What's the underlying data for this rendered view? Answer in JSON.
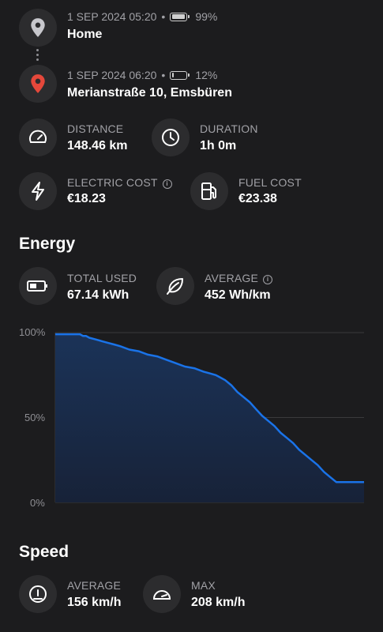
{
  "trip": {
    "start": {
      "datetime": "1 SEP 2024 05:20",
      "battery": "99%",
      "battery_level": 0.99,
      "place": "Home"
    },
    "end": {
      "datetime": "1 SEP 2024 06:20",
      "battery": "12%",
      "battery_level": 0.12,
      "place": "Merianstraße 10, Emsbüren"
    }
  },
  "stats": {
    "distance": {
      "label": "DISTANCE",
      "value": "148.46 km"
    },
    "duration": {
      "label": "DURATION",
      "value": "1h 0m"
    },
    "electric_cost": {
      "label": "ELECTRIC COST",
      "value": "€18.23"
    },
    "fuel_cost": {
      "label": "FUEL COST",
      "value": "€23.38"
    }
  },
  "energy": {
    "title": "Energy",
    "total_used": {
      "label": "TOTAL USED",
      "value": "67.14 kWh"
    },
    "average": {
      "label": "AVERAGE",
      "value": "452 Wh/km"
    }
  },
  "speed": {
    "title": "Speed",
    "average": {
      "label": "AVERAGE",
      "value": "156 km/h"
    },
    "max": {
      "label": "MAX",
      "value": "208 km/h"
    }
  },
  "colors": {
    "accent": "#1a73e8",
    "fill": "#1b3358",
    "pin_end": "#e5483b",
    "pin_start": "#c7c7cc"
  },
  "chart_data": {
    "type": "area",
    "y_ticks": [
      "100%",
      "50%",
      "0%"
    ],
    "ylim": [
      0,
      100
    ],
    "x": [
      0,
      8,
      9,
      10,
      11,
      13,
      15,
      17,
      19,
      21,
      24,
      27,
      30,
      33,
      36,
      39,
      42,
      45,
      48,
      50,
      52,
      53,
      55,
      57,
      59,
      61,
      63,
      65,
      67,
      69,
      71,
      73,
      75,
      77,
      79,
      81,
      83,
      85,
      87,
      89,
      91,
      93,
      95,
      97,
      100
    ],
    "values": [
      99,
      99,
      98,
      98,
      97,
      96,
      95,
      94,
      93,
      92,
      90,
      89,
      87,
      86,
      84,
      82,
      80,
      79,
      77,
      76,
      75,
      74,
      72,
      69,
      65,
      62,
      59,
      55,
      51,
      48,
      45,
      41,
      38,
      35,
      31,
      28,
      25,
      22,
      18,
      15,
      12,
      12,
      12,
      12,
      12
    ]
  }
}
